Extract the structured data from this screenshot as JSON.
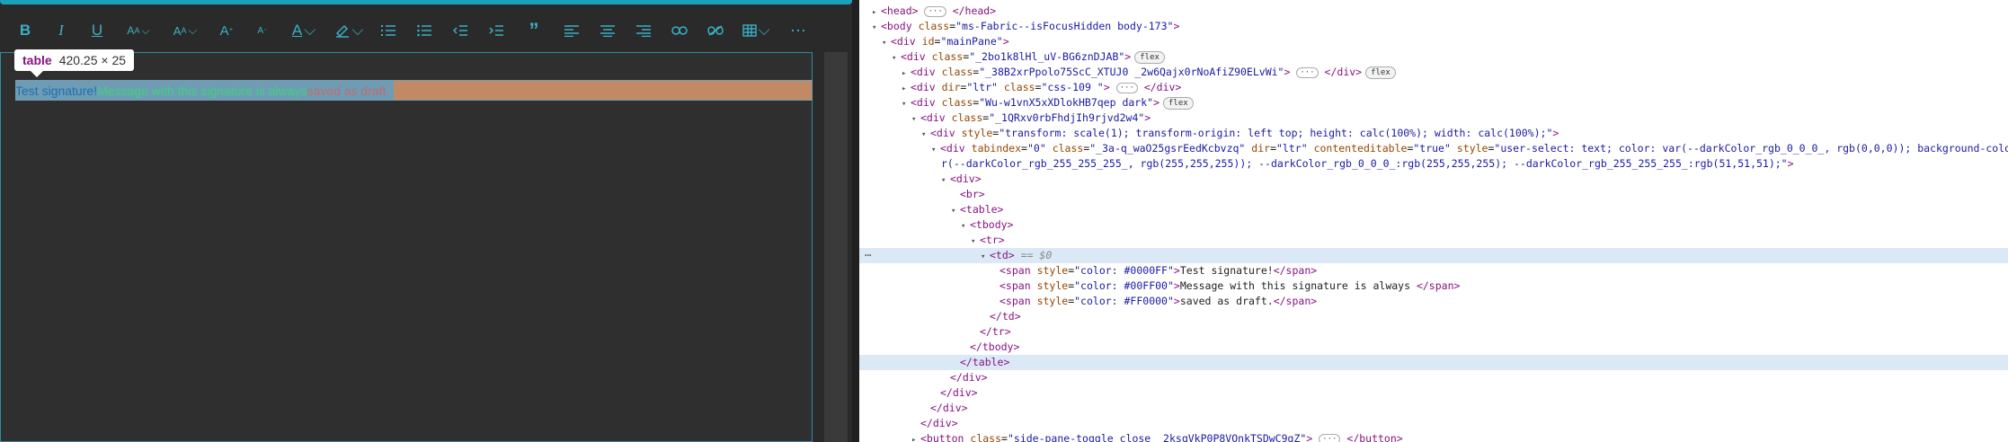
{
  "tooltip": {
    "tag": "table",
    "size": "420.25 × 25"
  },
  "signature": {
    "part1": "Test signature!",
    "part2": "Message with this signature is always ",
    "part3": "saved as draft."
  },
  "devtools": {
    "lines": [
      {
        "indent": 0,
        "html": "<span class='tw'>▸</span><span class='t'>&lt;head&gt;</span> <span class='ell'>···</span> <span class='t'>&lt;/head&gt;</span>"
      },
      {
        "indent": 0,
        "html": "<span class='tw'>▾</span><span class='t'>&lt;body</span> <span class='an'>class</span>=<span class='av'>\"ms-Fabric--isFocusHidden body-173\"</span><span class='t'>&gt;</span>"
      },
      {
        "indent": 1,
        "html": "<span class='tw'>▾</span><span class='t'>&lt;div</span> <span class='an'>id</span>=<span class='av'>\"mainPane\"</span><span class='t'>&gt;</span>"
      },
      {
        "indent": 2,
        "html": "<span class='tw'>▾</span><span class='t'>&lt;div</span> <span class='an'>class</span>=<span class='av'>\"_2bo1k8lHl_uV-BG6znDJAB\"</span><span class='t'>&gt;</span><span class='badge'>flex</span>"
      },
      {
        "indent": 3,
        "html": "<span class='tw'>▸</span><span class='t'>&lt;div</span> <span class='an'>class</span>=<span class='av'>\"_38B2xrPpolo75ScC_XTUJ0 _2w6Qajx0rNoAfiZ90ELvWi\"</span><span class='t'>&gt;</span> <span class='ell'>···</span> <span class='t'>&lt;/div&gt;</span><span class='badge'>flex</span>"
      },
      {
        "indent": 3,
        "html": "<span class='tw'>▸</span><span class='t'>&lt;div</span> <span class='an'>dir</span>=<span class='av'>\"ltr\"</span> <span class='an'>class</span>=<span class='av'>\"css-109 \"</span><span class='t'>&gt;</span> <span class='ell'>···</span> <span class='t'>&lt;/div&gt;</span>"
      },
      {
        "indent": 3,
        "html": "<span class='tw'>▾</span><span class='t'>&lt;div</span> <span class='an'>class</span>=<span class='av'>\"Wu-w1vnX5xXDlokHB7qep dark\"</span><span class='t'>&gt;</span><span class='badge'>flex</span>"
      },
      {
        "indent": 4,
        "html": "<span class='tw'>▾</span><span class='t'>&lt;div</span> <span class='an'>class</span>=<span class='av'>\"_1QRxv0rbFhdjIh9rjvd2w4\"</span><span class='t'>&gt;</span>"
      },
      {
        "indent": 5,
        "html": "<span class='tw'>▾</span><span class='t'>&lt;div</span> <span class='an'>style</span>=<span class='av'>\"transform: scale(1); transform-origin: left top; height: calc(100%); width: calc(100%);\"</span><span class='t'>&gt;</span>"
      },
      {
        "indent": 6,
        "html": "<span class='tw'>▾</span><span class='t'>&lt;div</span> <span class='an'>tabindex</span>=<span class='av'>\"0\"</span> <span class='an'>class</span>=<span class='av'>\"_3a-q_waO25gsrEedKcbvzq\"</span> <span class='an'>dir</span>=<span class='av'>\"ltr\"</span> <span class='an'>contenteditable</span>=<span class='av'>\"true\"</span> <span class='an'>style</span>=<span class='av'>\"user-select: text; color: var(--darkColor_rgb_0_0_0_, rgb(0,0,0)); background-color: va</span>"
      },
      {
        "indent": 7,
        "html": "<span class='av'>r(--darkColor_rgb_255_255_255_, rgb(255,255,255)); --darkColor_rgb_0_0_0_:rgb(255,255,255); --darkColor_rgb_255_255_255_:rgb(51,51,51);\"</span><span class='t'>&gt;</span>",
        "raw": true
      },
      {
        "indent": 7,
        "html": "<span class='tw'>▾</span><span class='t'>&lt;div&gt;</span>"
      },
      {
        "indent": 8,
        "html": "<span class='tw'></span><span class='t'>&lt;br&gt;</span>"
      },
      {
        "indent": 8,
        "html": "<span class='tw'>▾</span><span class='t'>&lt;table&gt;</span>"
      },
      {
        "indent": 9,
        "html": "<span class='tw'>▾</span><span class='t'>&lt;tbody&gt;</span>"
      },
      {
        "indent": 10,
        "html": "<span class='tw'>▾</span><span class='t'>&lt;tr&gt;</span>"
      },
      {
        "indent": 11,
        "html": "<span class='tw'>▾</span><span class='t'>&lt;td&gt;</span> <span class='eq'>== $0</span>",
        "hl": true
      },
      {
        "indent": 12,
        "html": "<span class='tw'></span><span class='t'>&lt;span</span> <span class='an'>style</span>=<span class='av'>\"color: #0000FF\"</span><span class='t'>&gt;</span><span class='txt'>Test signature!</span><span class='t'>&lt;/span&gt;</span>"
      },
      {
        "indent": 12,
        "html": "<span class='tw'></span><span class='t'>&lt;span</span> <span class='an'>style</span>=<span class='av'>\"color: #00FF00\"</span><span class='t'>&gt;</span><span class='txt'>Message with this signature is always </span><span class='t'>&lt;/span&gt;</span>"
      },
      {
        "indent": 12,
        "html": "<span class='tw'></span><span class='t'>&lt;span</span> <span class='an'>style</span>=<span class='av'>\"color: #FF0000\"</span><span class='t'>&gt;</span><span class='txt'>saved as draft.</span><span class='t'>&lt;/span&gt;</span>"
      },
      {
        "indent": 11,
        "html": "<span class='tw'></span><span class='t'>&lt;/td&gt;</span>"
      },
      {
        "indent": 10,
        "html": "<span class='tw'></span><span class='t'>&lt;/tr&gt;</span>"
      },
      {
        "indent": 9,
        "html": "<span class='tw'></span><span class='t'>&lt;/tbody&gt;</span>"
      },
      {
        "indent": 8,
        "html": "<span class='tw'></span><span class='t'>&lt;/table&gt;</span>",
        "hl2": true
      },
      {
        "indent": 7,
        "html": "<span class='tw'></span><span class='t'>&lt;/div&gt;</span>"
      },
      {
        "indent": 6,
        "html": "<span class='tw'></span><span class='t'>&lt;/div&gt;</span>"
      },
      {
        "indent": 5,
        "html": "<span class='tw'></span><span class='t'>&lt;/div&gt;</span>"
      },
      {
        "indent": 4,
        "html": "<span class='tw'></span><span class='t'>&lt;/div&gt;</span>"
      },
      {
        "indent": 4,
        "html": "<span class='tw'>▸</span><span class='t'>&lt;button</span> <span class='an'>class</span>=<span class='av'>\"side-pane-toggle close _2ksqVkP0P8VOnkTSDwC9gZ\"</span><span class='t'>&gt;</span> <span class='ell'>···</span> <span class='t'>&lt;/button&gt;</span>"
      }
    ]
  },
  "colors": {
    "accent": "#1aa3b8",
    "toolbar_icon": "#3ab0c4",
    "table_highlight": "#c28a64",
    "cell_highlight": "#6f9cb5"
  }
}
